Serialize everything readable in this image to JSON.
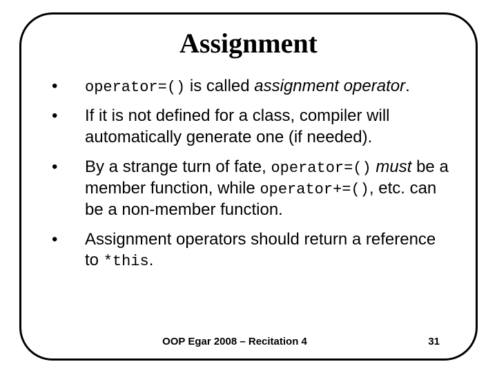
{
  "slide": {
    "title": "Assignment",
    "bullets": [
      {
        "pre_code": "operator=()",
        "text_a": " is called ",
        "italic": "assignment operator",
        "text_b": "."
      },
      {
        "text_a": "If it is not defined for a class, compiler will automatically generate one (if needed)."
      },
      {
        "text_a": "By a strange turn of fate, ",
        "code_a": "operator=()",
        "text_b": " ",
        "italic": "must",
        "text_c": " be a member function, while ",
        "code_b": "operator+=()",
        "text_d": ", etc. can be a non-member function."
      },
      {
        "text_a": "Assignment operators should return a reference to ",
        "code_a": "*this",
        "text_b": "."
      }
    ],
    "footer": "OOP Egar 2008 – Recitation 4",
    "page": "31"
  }
}
